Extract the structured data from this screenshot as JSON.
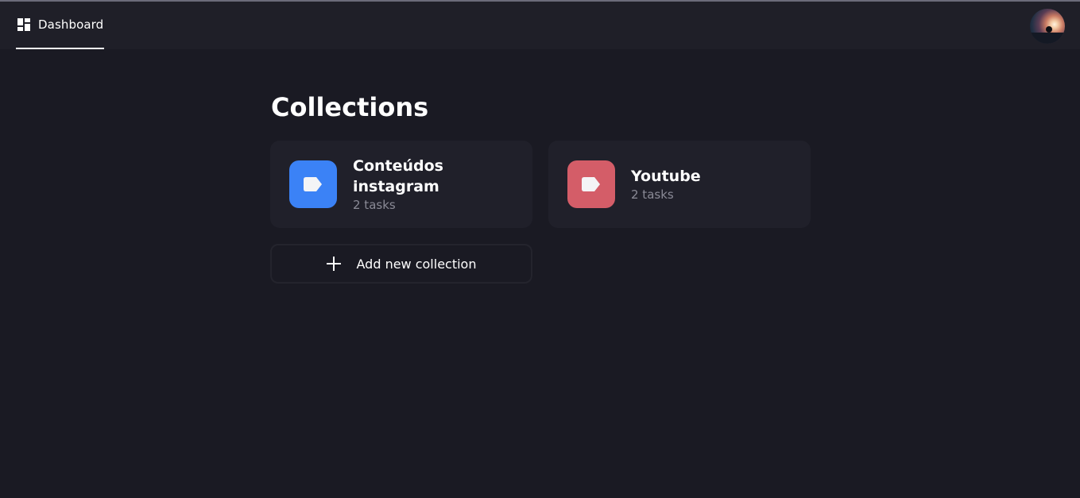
{
  "nav": {
    "tab_label": "Dashboard",
    "tab_icon": "dashboard-icon"
  },
  "user": {
    "avatar": "user-avatar"
  },
  "page": {
    "title": "Collections"
  },
  "collections": [
    {
      "title": "Conteúdos instagram",
      "subtitle": "2 tasks",
      "color": "#3b82f6",
      "icon": "label-icon"
    },
    {
      "title": "Youtube",
      "subtitle": "2 tasks",
      "color": "#d45d68",
      "icon": "label-icon"
    }
  ],
  "actions": {
    "add_collection_label": "Add new collection",
    "add_icon": "plus-icon"
  },
  "colors": {
    "background": "#1a1a23",
    "surface": "#20202a",
    "muted_text": "#8a8a96"
  }
}
